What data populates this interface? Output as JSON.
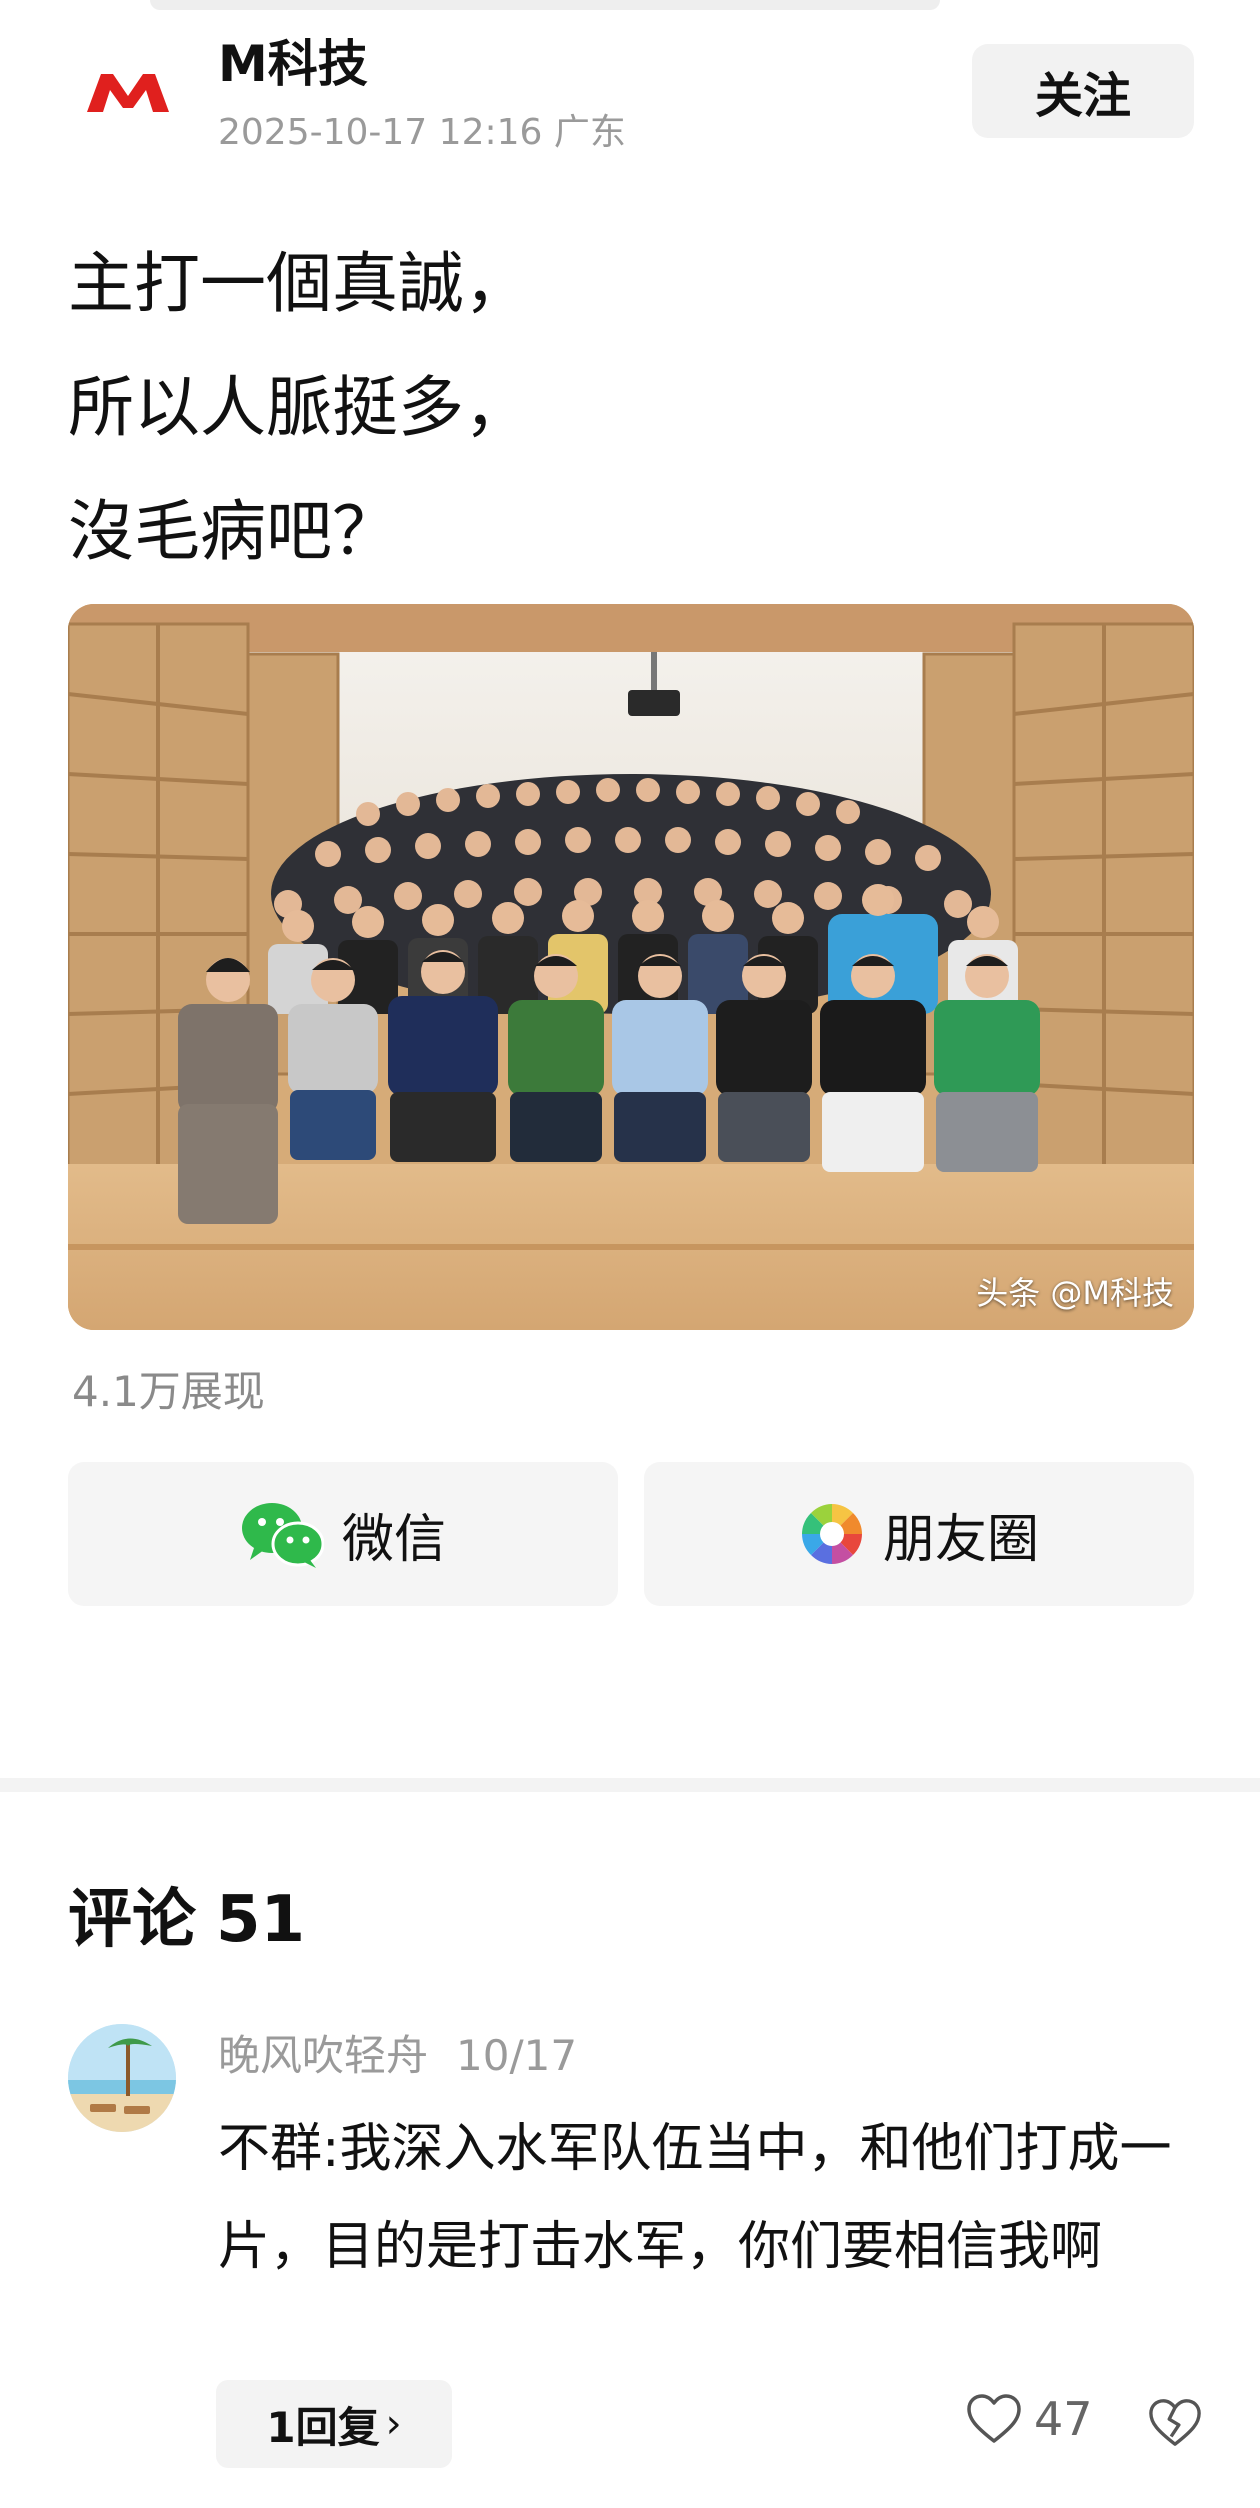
{
  "header": {
    "author_name": "M科技",
    "post_meta": "2025-10-17 12:16 广东",
    "follow_label": "关注",
    "logo_icon": "m-logo-icon",
    "brand_color": "#e0201e"
  },
  "post": {
    "lines": [
      "主打一個真誠，",
      "所以人脈挺多，",
      "沒毛病吧？"
    ],
    "photo_icon": "group-photo-image",
    "watermark": "头条 @M科技",
    "view_count": "4.1万展现"
  },
  "share": {
    "wechat_label": "微信",
    "moments_label": "朋友圈",
    "wechat_icon": "wechat-icon",
    "moments_icon": "moments-icon"
  },
  "comments": {
    "title": "评论",
    "count": "51",
    "items": [
      {
        "author": "晚风吹轻舟",
        "date": "10/17",
        "text": "不群:我深入水军队伍当中，和他们打成一片，目的是打击水军，你们要相信我啊",
        "reply_label": "1回复",
        "likes": "47"
      }
    ]
  }
}
